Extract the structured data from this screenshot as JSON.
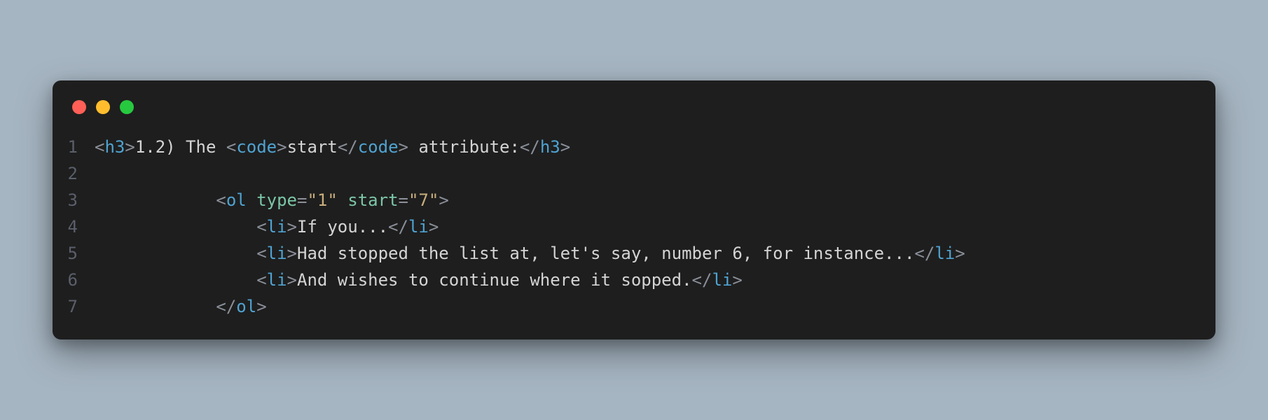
{
  "editor": {
    "window_controls": [
      "close",
      "minimize",
      "zoom"
    ],
    "language": "html",
    "syntax_colors": {
      "bracket": "#8a8f99",
      "tag": "#4fa3d1",
      "attr": "#7cc6a8",
      "operator": "#8a8f99",
      "string": "#c8ae7d",
      "text": "#d4d4d4",
      "gutter": "#5a5f6b",
      "background": "#1e1e1e"
    },
    "lines": [
      {
        "n": 1,
        "indent": "",
        "tokens": [
          {
            "t": "bracket",
            "v": "<"
          },
          {
            "t": "tag",
            "v": "h3"
          },
          {
            "t": "bracket",
            "v": ">"
          },
          {
            "t": "text",
            "v": "1.2) The "
          },
          {
            "t": "bracket",
            "v": "<"
          },
          {
            "t": "tag",
            "v": "code"
          },
          {
            "t": "bracket",
            "v": ">"
          },
          {
            "t": "text",
            "v": "start"
          },
          {
            "t": "bracket",
            "v": "</"
          },
          {
            "t": "tag",
            "v": "code"
          },
          {
            "t": "bracket",
            "v": ">"
          },
          {
            "t": "text",
            "v": " attribute:"
          },
          {
            "t": "bracket",
            "v": "</"
          },
          {
            "t": "tag",
            "v": "h3"
          },
          {
            "t": "bracket",
            "v": ">"
          }
        ]
      },
      {
        "n": 2,
        "indent": "",
        "tokens": []
      },
      {
        "n": 3,
        "indent": "            ",
        "tokens": [
          {
            "t": "bracket",
            "v": "<"
          },
          {
            "t": "tag",
            "v": "ol"
          },
          {
            "t": "text",
            "v": " "
          },
          {
            "t": "attr",
            "v": "type"
          },
          {
            "t": "op",
            "v": "="
          },
          {
            "t": "string",
            "v": "\"1\""
          },
          {
            "t": "text",
            "v": " "
          },
          {
            "t": "attr",
            "v": "start"
          },
          {
            "t": "op",
            "v": "="
          },
          {
            "t": "string",
            "v": "\"7\""
          },
          {
            "t": "bracket",
            "v": ">"
          }
        ]
      },
      {
        "n": 4,
        "indent": "                ",
        "tokens": [
          {
            "t": "bracket",
            "v": "<"
          },
          {
            "t": "tag",
            "v": "li"
          },
          {
            "t": "bracket",
            "v": ">"
          },
          {
            "t": "text",
            "v": "If you..."
          },
          {
            "t": "bracket",
            "v": "</"
          },
          {
            "t": "tag",
            "v": "li"
          },
          {
            "t": "bracket",
            "v": ">"
          }
        ]
      },
      {
        "n": 5,
        "indent": "                ",
        "tokens": [
          {
            "t": "bracket",
            "v": "<"
          },
          {
            "t": "tag",
            "v": "li"
          },
          {
            "t": "bracket",
            "v": ">"
          },
          {
            "t": "text",
            "v": "Had stopped the list at, let's say, number 6, for instance..."
          },
          {
            "t": "bracket",
            "v": "</"
          },
          {
            "t": "tag",
            "v": "li"
          },
          {
            "t": "bracket",
            "v": ">"
          }
        ]
      },
      {
        "n": 6,
        "indent": "                ",
        "tokens": [
          {
            "t": "bracket",
            "v": "<"
          },
          {
            "t": "tag",
            "v": "li"
          },
          {
            "t": "bracket",
            "v": ">"
          },
          {
            "t": "text",
            "v": "And wishes to continue where it sopped."
          },
          {
            "t": "bracket",
            "v": "</"
          },
          {
            "t": "tag",
            "v": "li"
          },
          {
            "t": "bracket",
            "v": ">"
          }
        ]
      },
      {
        "n": 7,
        "indent": "            ",
        "tokens": [
          {
            "t": "bracket",
            "v": "</"
          },
          {
            "t": "tag",
            "v": "ol"
          },
          {
            "t": "bracket",
            "v": ">"
          }
        ]
      }
    ]
  }
}
